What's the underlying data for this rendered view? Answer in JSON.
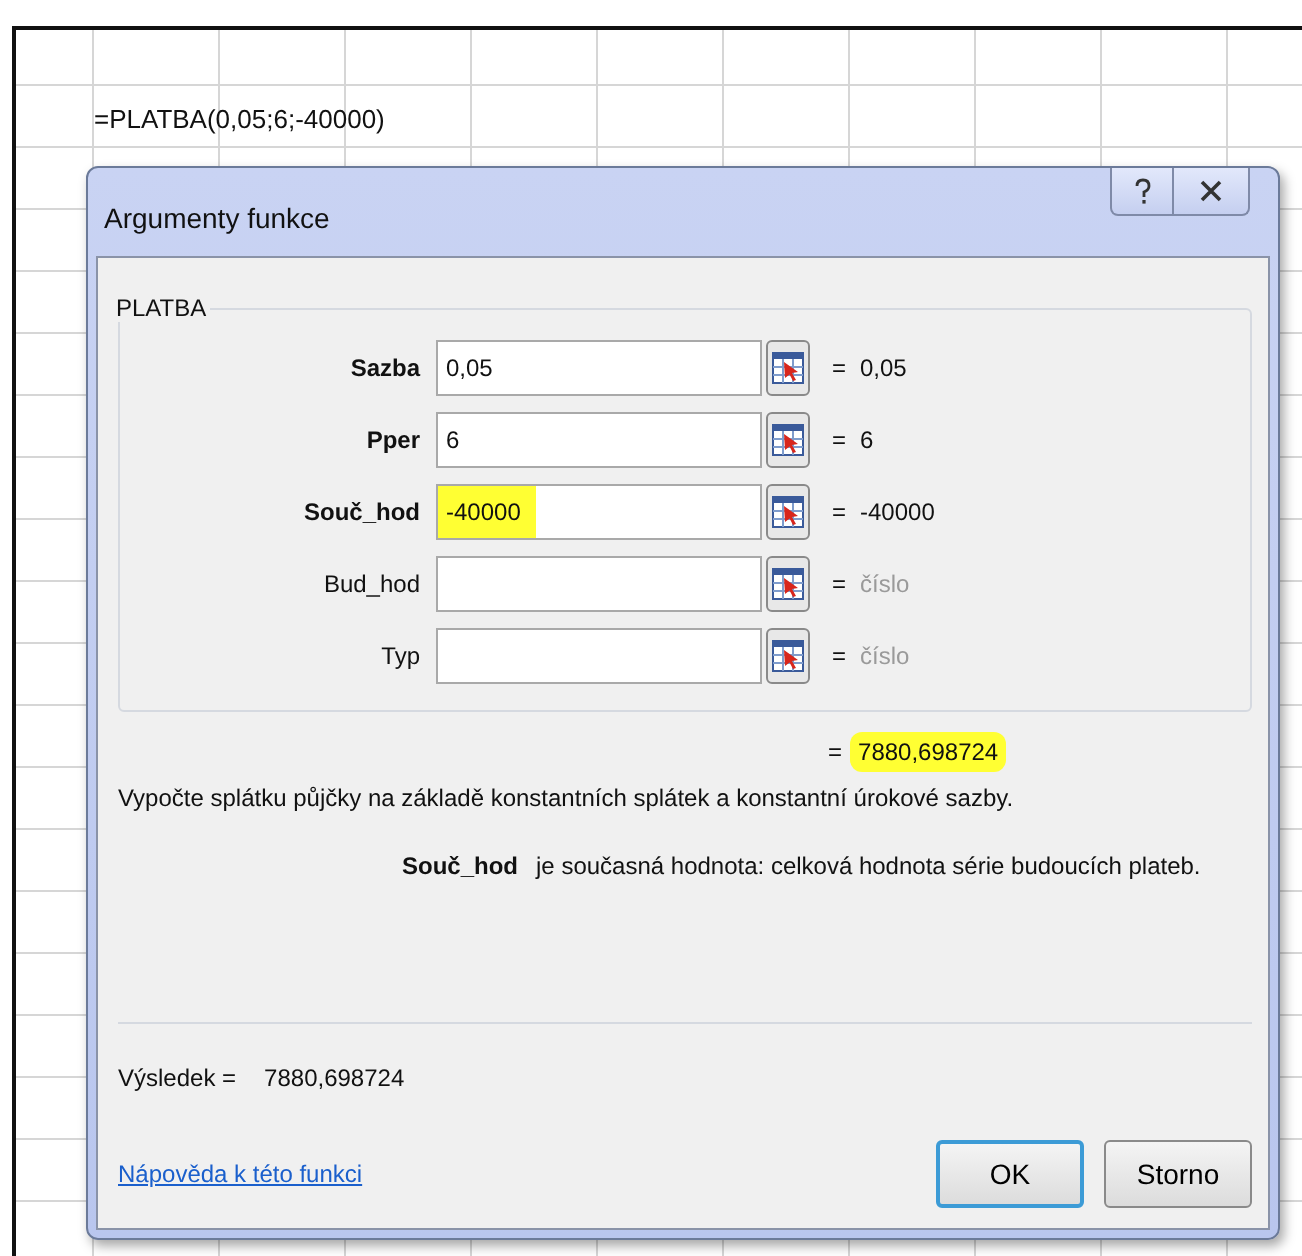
{
  "sheet": {
    "formula": "=PLATBA(0,05;6;-40000)"
  },
  "dialog": {
    "title": "Argumenty funkce",
    "function_name": "PLATBA",
    "arguments": [
      {
        "label": "Sazba",
        "required": true,
        "value": "0,05",
        "highlighted": false,
        "equals": "=",
        "result": "0,05",
        "muted": false
      },
      {
        "label": "Pper",
        "required": true,
        "value": "6",
        "highlighted": false,
        "equals": "=",
        "result": "6",
        "muted": false
      },
      {
        "label": "Souč_hod",
        "required": true,
        "value": "-40000",
        "highlighted": true,
        "equals": "=",
        "result": "-40000",
        "muted": false
      },
      {
        "label": "Bud_hod",
        "required": false,
        "highlighted": false,
        "equals": "=",
        "result": "číslo",
        "muted": true
      },
      {
        "label": "Typ",
        "required": false,
        "highlighted": false,
        "equals": "=",
        "result": "číslo",
        "muted": true
      }
    ],
    "formula_result": {
      "equals": "=",
      "value": "7880,698724",
      "highlighted": true
    },
    "description": "Vypočte splátku půjčky na základě konstantních splátek a konstantní úrokové sazby.",
    "argument_help": {
      "name": "Souč_hod",
      "text": "je současná hodnota: celková hodnota série budoucích plateb."
    },
    "result": {
      "label": "Výsledek =",
      "value": "7880,698724"
    },
    "help_link": "Nápověda k této funkci",
    "buttons": [
      {
        "label": "OK",
        "default": true
      },
      {
        "label": "Storno",
        "default": false
      }
    ]
  }
}
